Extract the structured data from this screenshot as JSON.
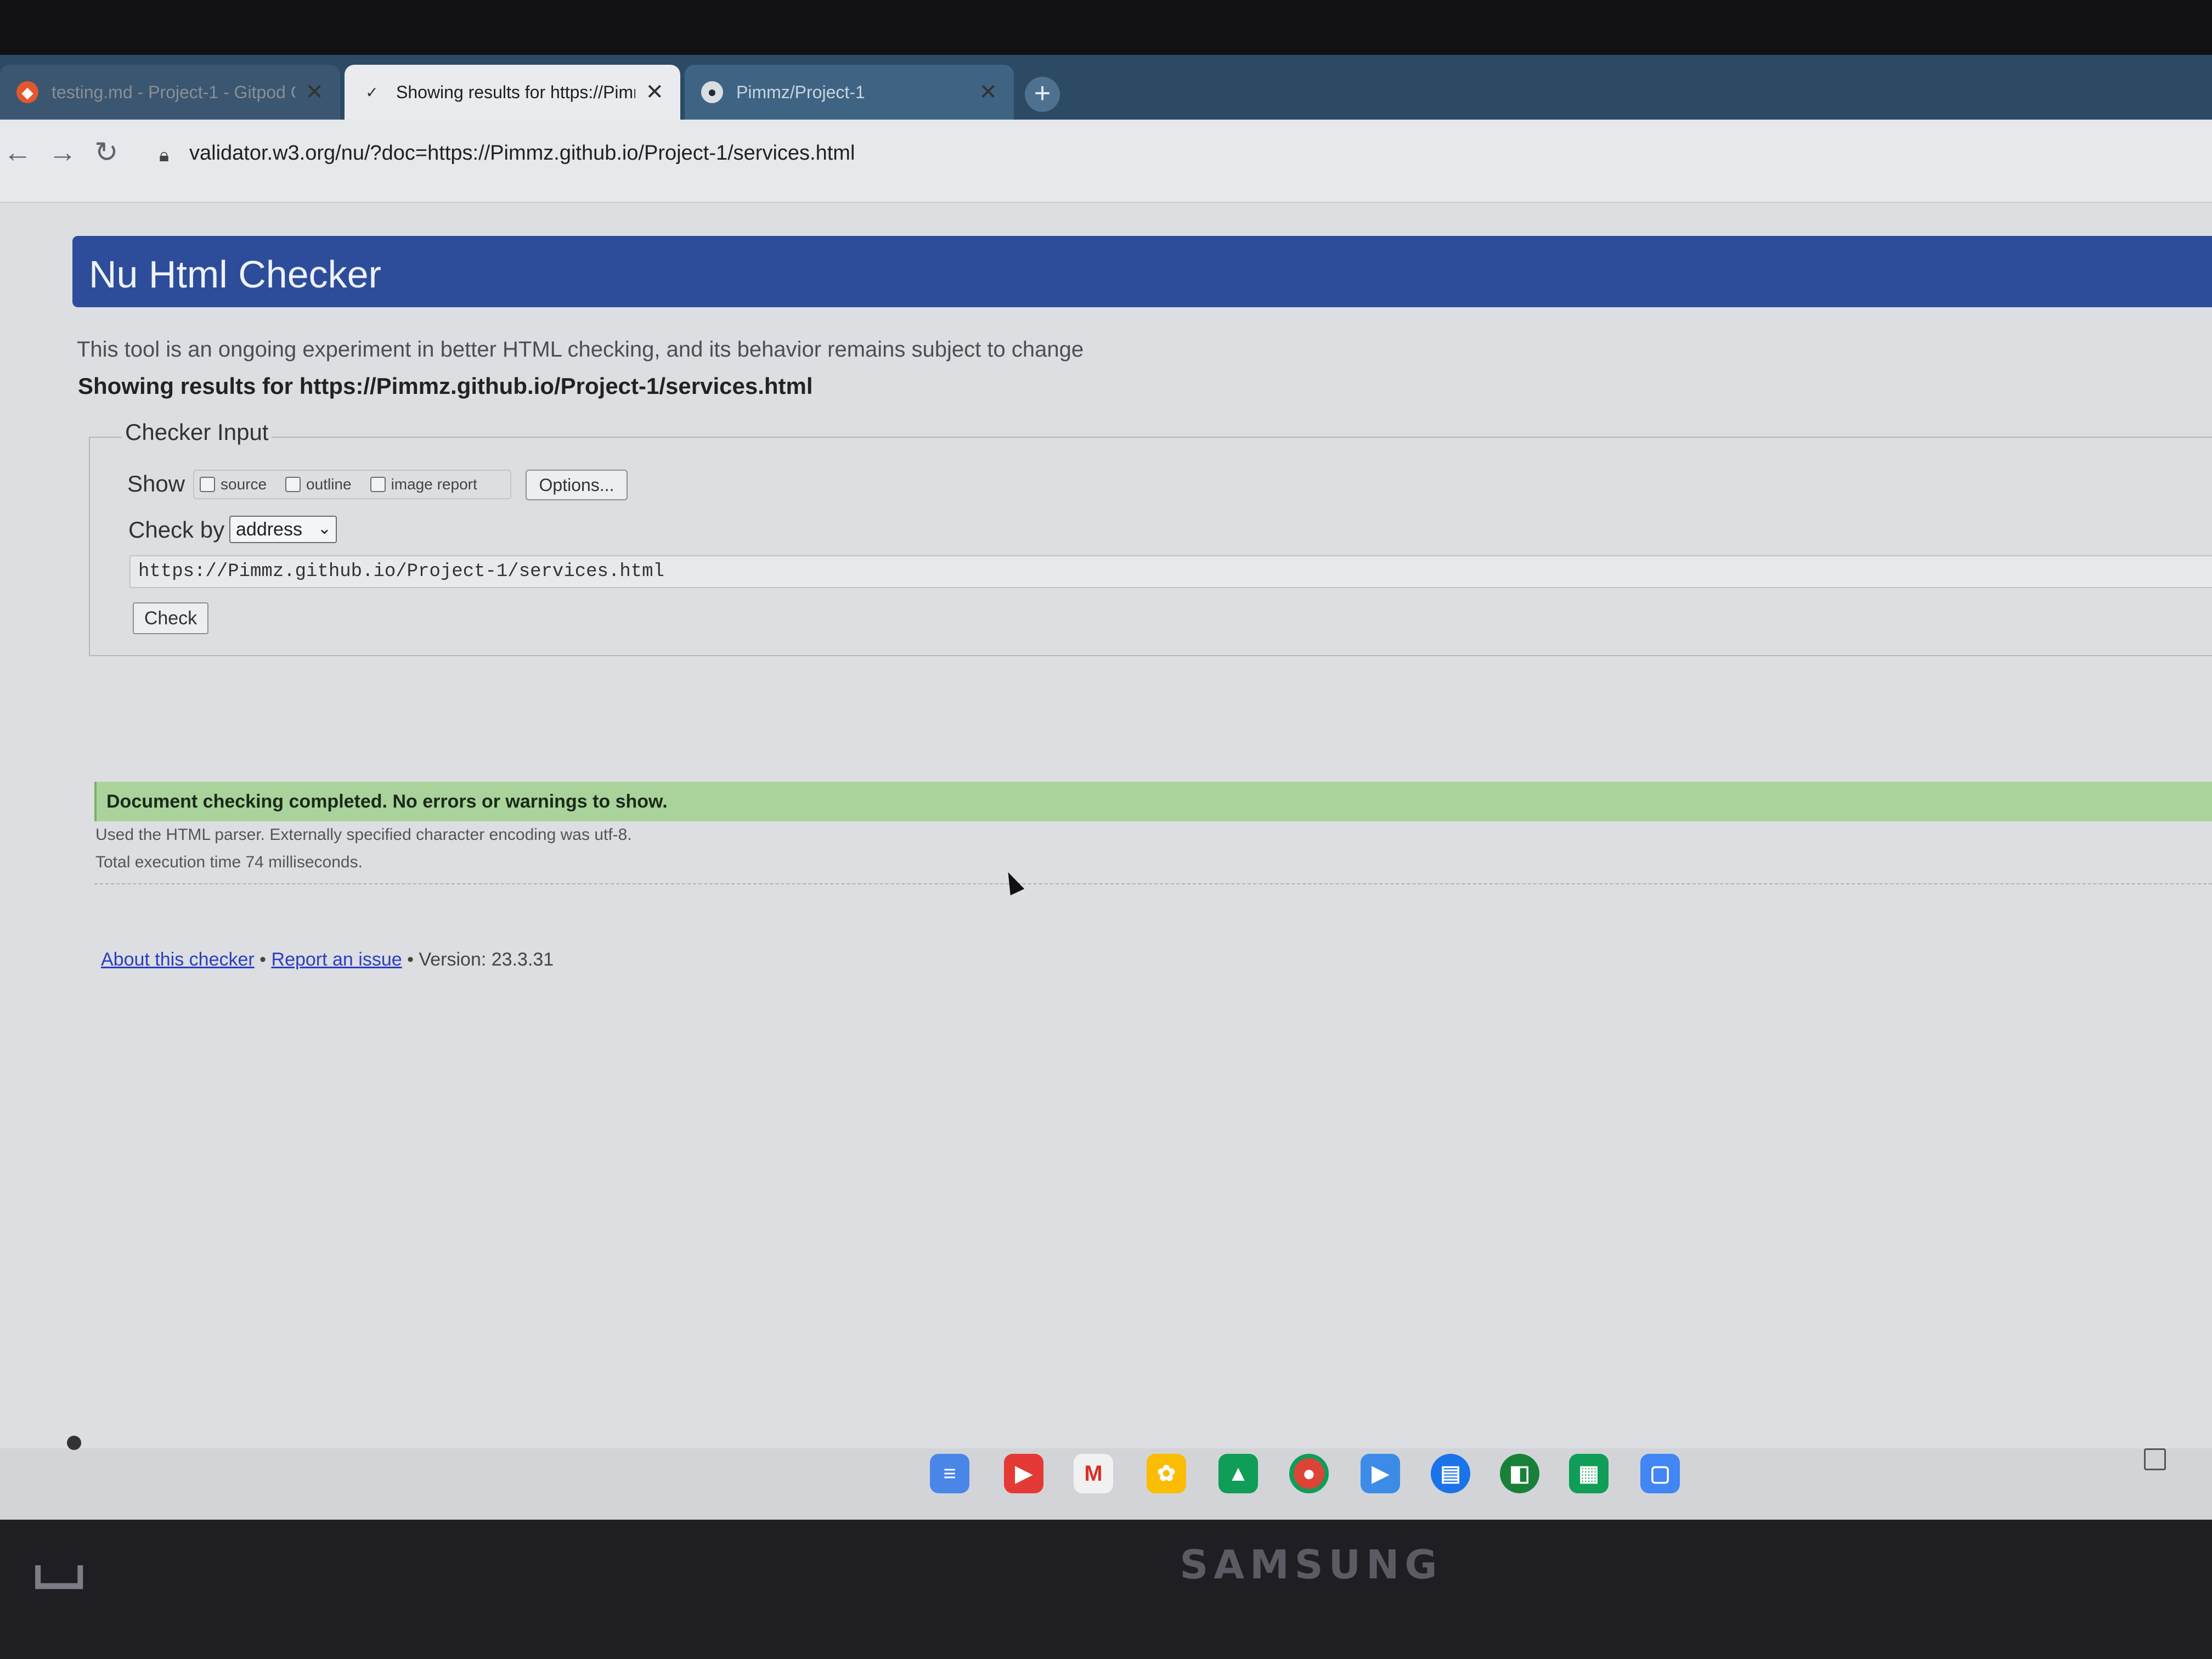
{
  "browser": {
    "tabs": [
      {
        "title": "testing.md - Project-1 - Gitpod C",
        "icon": "gitpod-icon"
      },
      {
        "title": "Showing results for https://Pimm",
        "icon": "w3c-validator-icon"
      },
      {
        "title": "Pimmz/Project-1",
        "icon": "github-icon"
      }
    ],
    "new_tab_label": "+",
    "url": "validator.w3.org/nu/?doc=https://Pimmz.github.io/Project-1/services.html"
  },
  "page": {
    "title": "Nu Html Checker",
    "subtitle": "This tool is an ongoing experiment in better HTML checking, and its behavior remains subject to change",
    "results_heading": "Showing results for https://Pimmz.github.io/Project-1/services.html",
    "checker_input": {
      "legend": "Checker Input",
      "show_label": "Show",
      "show_options": [
        "source",
        "outline",
        "image report"
      ],
      "options_button": "Options...",
      "check_by_label": "Check by",
      "check_by_value": "address",
      "url_value": "https://Pimmz.github.io/Project-1/services.html",
      "check_button": "Check"
    },
    "result_message": "Document checking completed. No errors or warnings to show.",
    "details": [
      "Used the HTML parser. Externally specified character encoding was utf-8.",
      "Total execution time 74 milliseconds."
    ],
    "footer": {
      "about_link": "About this checker",
      "separator": "•",
      "report_link": "Report an issue",
      "version": "Version: 23.3.31"
    }
  },
  "device": {
    "brand": "SAMSUNG"
  },
  "colors": {
    "banner": "#2d4d9a",
    "success": "#a9d39a",
    "link": "#2a3ec2"
  }
}
